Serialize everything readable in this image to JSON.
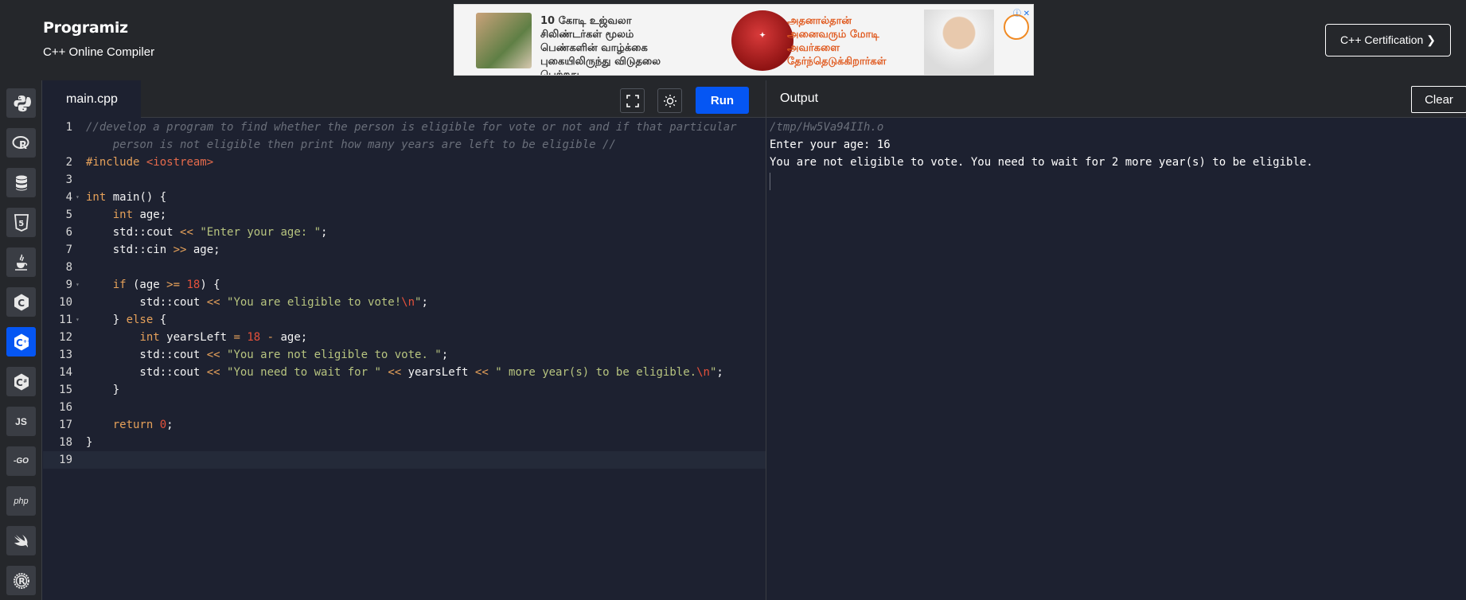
{
  "header": {
    "logo": "Programiz",
    "subtitle": "C++ Online Compiler",
    "cert_button": "C++ Certification ❯"
  },
  "ad": {
    "left_text": "10 கோடி உஜ்வலா சிலிண்டர்கள் மூலம் பெண்களின் வாழ்க்கை புகையிலிருந்து விடுதலை பெற்றது.",
    "right_text": "அதனால்தான் அனைவரும் மோடி அவர்களை தேர்ந்தெடுக்கிறார்கள்"
  },
  "languages": [
    {
      "name": "python",
      "icon": "python-icon"
    },
    {
      "name": "r",
      "icon": "r-icon",
      "label": "R"
    },
    {
      "name": "sql",
      "icon": "database-icon"
    },
    {
      "name": "html",
      "icon": "html5-icon",
      "label": "5"
    },
    {
      "name": "java",
      "icon": "java-icon"
    },
    {
      "name": "c",
      "icon": "c-icon"
    },
    {
      "name": "cpp",
      "icon": "cpp-icon",
      "active": true
    },
    {
      "name": "csharp",
      "icon": "csharp-icon"
    },
    {
      "name": "javascript",
      "icon": "js-icon",
      "label": "JS"
    },
    {
      "name": "go",
      "icon": "go-icon",
      "label": "-GO"
    },
    {
      "name": "php",
      "icon": "php-icon",
      "label": "php"
    },
    {
      "name": "swift",
      "icon": "swift-icon"
    },
    {
      "name": "rust",
      "icon": "rust-icon",
      "label": "R"
    }
  ],
  "editor": {
    "file_tab": "main.cpp",
    "run_label": "Run",
    "lines": [
      {
        "n": "1",
        "fold": false,
        "html": "<span class=\"comment\">//develop a program to find whether the person is eligible for vote or not and if that particular\n    person is not eligible then print how many years are left to be eligible //</span>"
      },
      {
        "n": "2",
        "fold": false,
        "html": "<span class=\"pp\">#include</span> <span class=\"inc\">&lt;iostream&gt;</span>"
      },
      {
        "n": "3",
        "fold": false,
        "html": ""
      },
      {
        "n": "4",
        "fold": true,
        "html": "<span class=\"kw\">int</span> main() {"
      },
      {
        "n": "5",
        "fold": false,
        "html": "    <span class=\"kw\">int</span> age;"
      },
      {
        "n": "6",
        "fold": false,
        "html": "    std::cout <span class=\"op\">&lt;&lt;</span> <span class=\"str\">\"Enter your age: \"</span>;"
      },
      {
        "n": "7",
        "fold": false,
        "html": "    std::cin <span class=\"op\">&gt;&gt;</span> age;"
      },
      {
        "n": "8",
        "fold": false,
        "html": ""
      },
      {
        "n": "9",
        "fold": true,
        "html": "    <span class=\"kw\">if</span> (age <span class=\"op\">&gt;=</span> <span class=\"num\">18</span>) {"
      },
      {
        "n": "10",
        "fold": false,
        "html": "        std::cout <span class=\"op\">&lt;&lt;</span> <span class=\"str\">\"You are eligible to vote!</span><span class=\"esc\">\\n</span><span class=\"str\">\"</span>;"
      },
      {
        "n": "11",
        "fold": true,
        "html": "    } <span class=\"kw\">else</span> {"
      },
      {
        "n": "12",
        "fold": false,
        "html": "        <span class=\"kw\">int</span> yearsLeft <span class=\"op\">=</span> <span class=\"num\">18</span> <span class=\"op\">-</span> age;"
      },
      {
        "n": "13",
        "fold": false,
        "html": "        std::cout <span class=\"op\">&lt;&lt;</span> <span class=\"str\">\"You are not eligible to vote. \"</span>;"
      },
      {
        "n": "14",
        "fold": false,
        "html": "        std::cout <span class=\"op\">&lt;&lt;</span> <span class=\"str\">\"You need to wait for \"</span> <span class=\"op\">&lt;&lt;</span> yearsLeft <span class=\"op\">&lt;&lt;</span> <span class=\"str\">\" more year(s) to be eligible.</span><span class=\"esc\">\\n</span><span class=\"str\">\"</span>;"
      },
      {
        "n": "15",
        "fold": false,
        "html": "    }"
      },
      {
        "n": "16",
        "fold": false,
        "html": ""
      },
      {
        "n": "17",
        "fold": false,
        "html": "    <span class=\"kw\">return</span> <span class=\"num\">0</span>;"
      },
      {
        "n": "18",
        "fold": false,
        "html": "}"
      },
      {
        "n": "19",
        "fold": false,
        "html": ""
      }
    ]
  },
  "output": {
    "title": "Output",
    "clear_label": "Clear",
    "path": "/tmp/Hw5Va94IIh.o",
    "lines": [
      "Enter your age: 16",
      "You are not eligible to vote. You need to wait for 2 more year(s) to be eligible."
    ]
  }
}
